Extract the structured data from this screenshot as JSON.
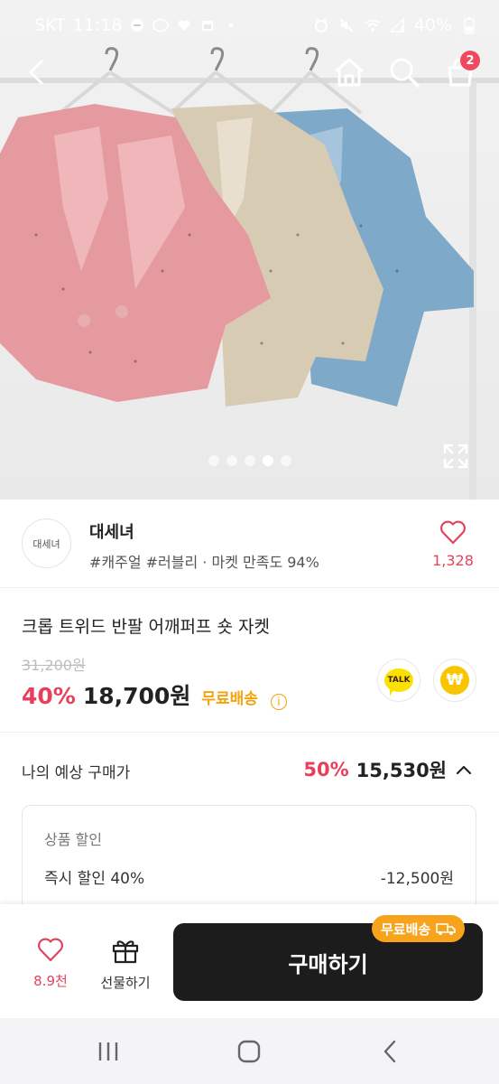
{
  "status_bar": {
    "carrier": "SKT",
    "time": "11:18",
    "battery": "40%"
  },
  "header": {
    "back_icon": "back-arrow-icon",
    "home_icon": "home-icon",
    "search_icon": "search-icon",
    "cart_icon": "cart-icon",
    "cart_count": "2"
  },
  "gallery": {
    "dots_count": 5,
    "active_dot": 4
  },
  "seller": {
    "avatar_text": "대세녀",
    "name": "대세녀",
    "meta": "#캐주얼 #러블리 · 마켓 만족도 94%",
    "like_count": "1,328"
  },
  "product": {
    "title": "크롭 트위드 반팔 어깨퍼프 숏 자켓",
    "original_price": "31,200원",
    "discount_rate": "40%",
    "sale_price": "18,700원",
    "shipping": "무료배송",
    "talk_label": "TALK",
    "won_symbol": "₩"
  },
  "expected": {
    "label": "나의 예상 구매가",
    "rate": "50%",
    "price": "15,530원",
    "breakdown": {
      "header": "상품 할인",
      "row_label": "즉시 할인 40%",
      "row_value": "-12,500원"
    }
  },
  "bottom": {
    "like_count": "8.9천",
    "gift_label": "선물하기",
    "buy_label": "구매하기",
    "ship_tag": "무료배송"
  },
  "colors": {
    "accent_pink": "#e8405a",
    "shipping_orange": "#f5a20b",
    "buy_button": "#1c1c1c"
  }
}
